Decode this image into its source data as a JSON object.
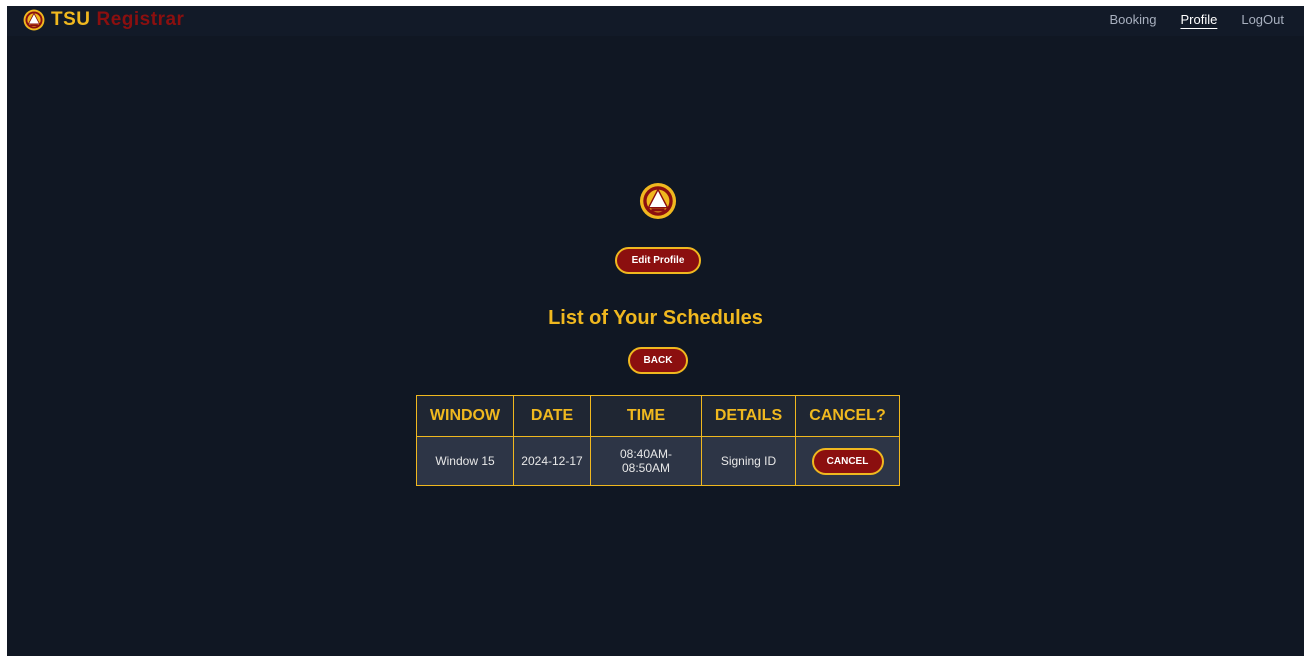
{
  "header": {
    "brand_tsu": "TSU",
    "brand_registrar": "Registrar",
    "nav": [
      {
        "label": "Booking"
      },
      {
        "label": "Profile",
        "active": true
      },
      {
        "label": "LogOut"
      }
    ]
  },
  "profile": {
    "edit_label": "Edit Profile"
  },
  "schedules": {
    "title": "List of Your Schedules",
    "back_label": "BACK",
    "columns": [
      "WINDOW",
      "DATE",
      "TIME",
      "DETAILS",
      "CANCEL?"
    ],
    "rows": [
      {
        "window": "Window 15",
        "date": "2024-12-17",
        "time": "08:40AM-08:50AM",
        "details": "Signing ID",
        "cancel_label": "CANCEL"
      }
    ]
  },
  "colors": {
    "background": "#101723",
    "accent_gold": "#f0b81f",
    "brand_maroon": "#8b0f0f",
    "table_row": "#2d3546"
  },
  "icons": {
    "logo": "university-seal-icon"
  }
}
